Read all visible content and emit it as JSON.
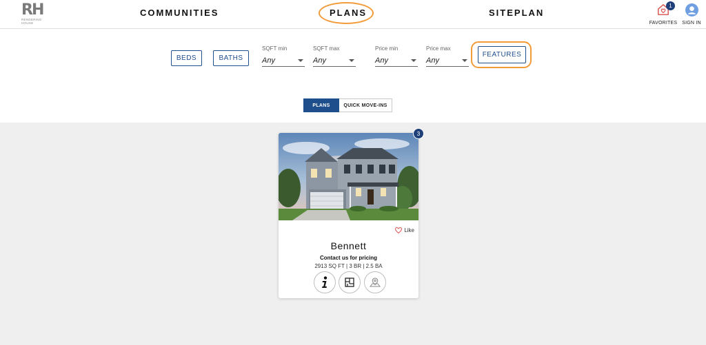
{
  "brand": {
    "mark": "RH",
    "sub_line1": "RENDERING",
    "sub_line2": "HOUSE"
  },
  "nav": {
    "communities": "COMMUNITIES",
    "plans": "PLANS",
    "siteplan": "SITEPLAN"
  },
  "header_actions": {
    "favorites_label": "FAVORITES",
    "favorites_count": "1",
    "signin_label": "SIGN IN"
  },
  "filters": {
    "beds_label": "BEDS",
    "baths_label": "BATHS",
    "sqft_min": {
      "label": "SQFT min",
      "value": "Any"
    },
    "sqft_max": {
      "label": "SQFT max",
      "value": "Any"
    },
    "price_min": {
      "label": "Price min",
      "value": "Any"
    },
    "price_max": {
      "label": "Price max",
      "value": "Any"
    },
    "features_label": "FEATURES"
  },
  "view_toggle": {
    "plans": "PLANS",
    "quick_move_ins": "QUICK MOVE-INS",
    "active": "plans"
  },
  "card": {
    "badge": "3",
    "like_label": "Like",
    "name": "Bennett",
    "pricing": "Contact us for pricing",
    "specs": "2913 SQ FT | 3 BR | 2.5 BA",
    "icons": [
      "info-icon",
      "floorplan-icon",
      "map-pin-icon"
    ]
  },
  "colors": {
    "accent_blue": "#1f4e8c",
    "badge_navy": "#1f3f7a",
    "highlight_orange": "#f29b38",
    "grid_bg": "#efefef"
  }
}
